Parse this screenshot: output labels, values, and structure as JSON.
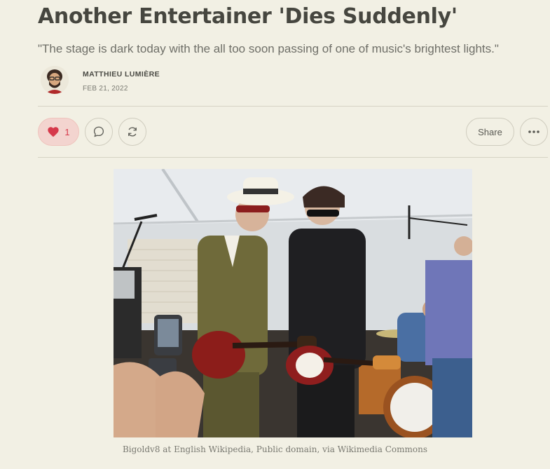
{
  "post": {
    "title": "Another Entertainer 'Dies Suddenly'",
    "subtitle": "\"The stage is dark today with the all too soon passing of one of music's brightest lights.\"",
    "author": "MATTHIEU LUMIÈRE",
    "date": "FEB 21, 2022"
  },
  "actions": {
    "like_count": "1",
    "share_label": "Share",
    "icons": [
      "heart-icon",
      "comment-icon",
      "restack-icon",
      "more-icon"
    ]
  },
  "image": {
    "caption": "Bigoldv8 at English Wikipedia, Public domain, via Wikimedia Commons"
  },
  "colors": {
    "background": "#f2f0e4",
    "like_accent": "#d6394b",
    "like_bg": "#f3d4cf"
  }
}
